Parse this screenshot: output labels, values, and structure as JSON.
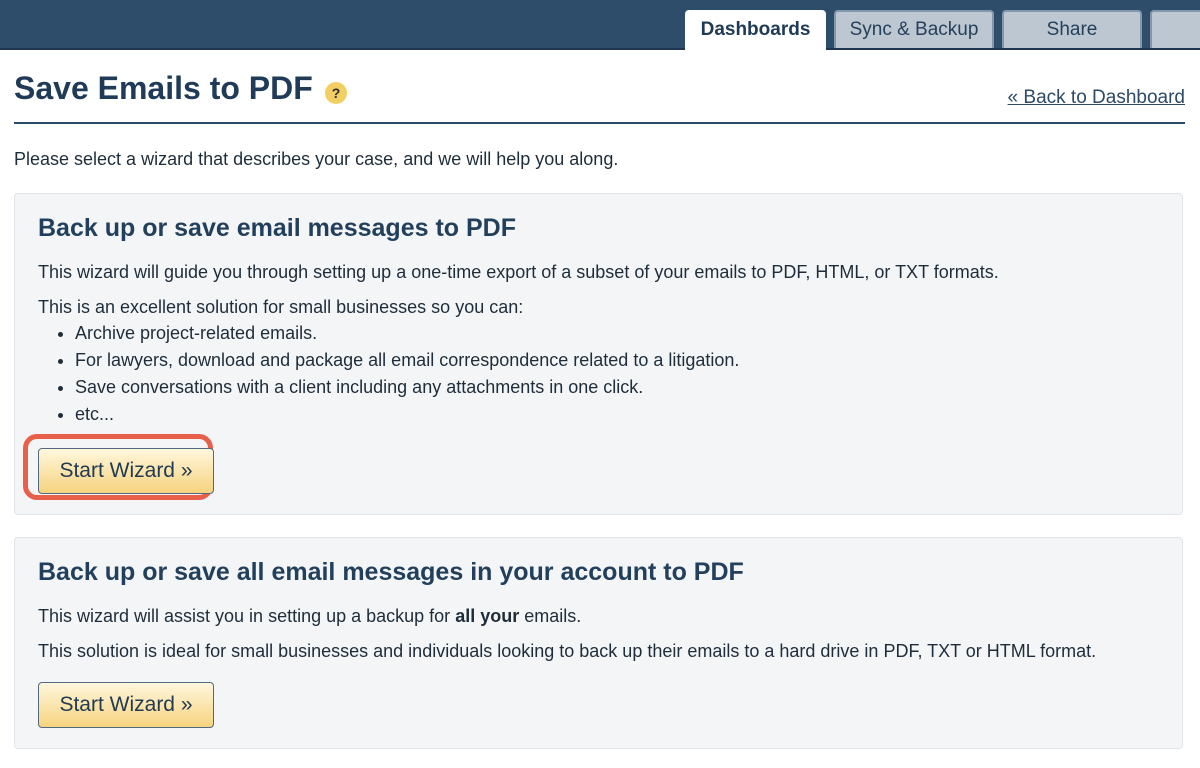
{
  "nav": {
    "tabs": [
      {
        "label": "Dashboards",
        "active": true
      },
      {
        "label": "Sync & Backup",
        "active": false
      },
      {
        "label": "Share",
        "active": false
      }
    ]
  },
  "header": {
    "title": "Save Emails to PDF",
    "help_icon": "?",
    "back_link": "« Back to Dashboard"
  },
  "intro": "Please select a wizard that describes your case, and we will help you along.",
  "wizards": [
    {
      "title": "Back up or save email messages to PDF",
      "description": "This wizard will guide you through setting up a one-time export of a subset of your emails to PDF, HTML, or TXT formats.",
      "lead": "This is an excellent solution for small businesses so you can:",
      "bullets": [
        "Archive project-related emails.",
        "For lawyers, download and package all email correspondence related to a litigation.",
        "Save conversations with a client including any attachments in one click.",
        "etc..."
      ],
      "button_label": "Start Wizard  »"
    },
    {
      "title": "Back up or save all email messages in your account to PDF",
      "description_prefix": "This wizard will assist you in setting up a backup for ",
      "description_bold": "all your",
      "description_suffix": " emails.",
      "detail": "This solution is ideal for small businesses and individuals looking to back up their emails to a hard drive in PDF, TXT or HTML format.",
      "button_label": "Start Wizard  »"
    }
  ],
  "colors": {
    "topbar": "#2e4d6b",
    "highlight": "#e8604a",
    "button_gradient_bottom": "#f6d37e"
  }
}
